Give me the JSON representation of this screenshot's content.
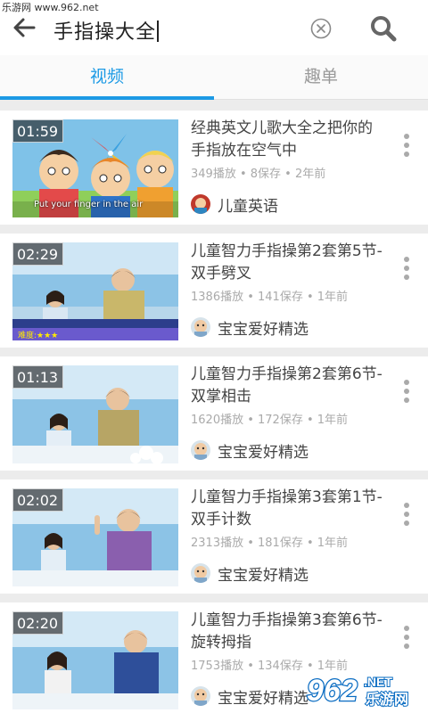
{
  "watermark": {
    "top_text": "乐游网 www.962.net",
    "logo_main": "962",
    "logo_suffix": ".NET",
    "logo_sub": "乐游网"
  },
  "search": {
    "query": "手指操大全"
  },
  "tabs": [
    {
      "label": "视频",
      "active": true
    },
    {
      "label": "趣单",
      "active": false
    }
  ],
  "colors": {
    "accent": "#1c9ae5"
  },
  "videos": [
    {
      "duration": "01:59",
      "title": "经典英文儿歌大全之把你的手指放在空气中",
      "stats": "349播放 • 8保存 • 2年前",
      "channel": "儿童英语",
      "thumb_caption": "Put your finger in the air"
    },
    {
      "duration": "02:29",
      "title": "儿童智力手指操第2套第5节-双手劈叉",
      "stats": "1386播放 • 141保存 • 1年前",
      "channel": "宝宝爱好精选",
      "thumb_caption": "难度:★★★"
    },
    {
      "duration": "01:13",
      "title": "儿童智力手指操第2套第6节-双掌相击",
      "stats": "1620播放 • 172保存 • 1年前",
      "channel": "宝宝爱好精选",
      "thumb_caption": ""
    },
    {
      "duration": "02:02",
      "title": "儿童智力手指操第3套第1节-双手计数",
      "stats": "2313播放 • 181保存 • 1年前",
      "channel": "宝宝爱好精选",
      "thumb_caption": ""
    },
    {
      "duration": "02:20",
      "title": "儿童智力手指操第3套第6节-旋转拇指",
      "stats": "1753播放 • 134保存 • 1年前",
      "channel": "宝宝爱好精选",
      "thumb_caption": ""
    }
  ]
}
